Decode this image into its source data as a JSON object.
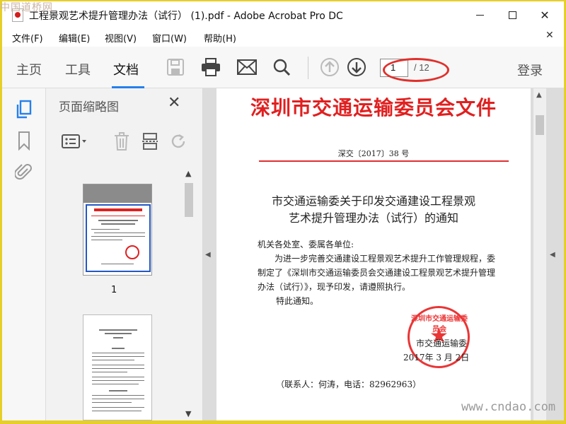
{
  "window": {
    "title": "工程景观艺术提升管理办法（试行） (1).pdf - Adobe Acrobat Pro DC"
  },
  "watermarks": {
    "top_left": "中国道桥网",
    "bottom_right": "www.cndao.com"
  },
  "menu": [
    "文件(F)",
    "编辑(E)",
    "视图(V)",
    "窗口(W)",
    "帮助(H)"
  ],
  "toolbar": {
    "tabs": [
      "主页",
      "工具",
      "文档"
    ],
    "active_tab": "文档",
    "page_current": "1",
    "page_total": "/ 12",
    "sign_in": "登录",
    "accent_color": "#2680eb",
    "annotation_color": "#e0302c"
  },
  "thumbnail_panel": {
    "title": "页面缩略图",
    "page_labels": [
      "1"
    ]
  },
  "document": {
    "header": "深圳市交通运输委员会文件",
    "number": "深交〔2017〕38 号",
    "title_lines": [
      "市交通运输委关于印发交通建设工程景观",
      "艺术提升管理办法（试行）的通知"
    ],
    "body_lines": [
      "机关各处室、委属各单位:",
      "为进一步完善交通建设工程景观艺术提升工作管理规程，委",
      "制定了《深圳市交通运输委员会交通建设工程景观艺术提升管理",
      "办法（试行）》，现予印发，请遵照执行。",
      "特此通知。"
    ],
    "seal_text": "深圳市交通运输委员会",
    "signature_org": "市交通运输委",
    "signature_date": "2017年 3 月 2日",
    "contact": "（联系人：何涛，电话：82962963）",
    "header_color": "#e02020"
  }
}
